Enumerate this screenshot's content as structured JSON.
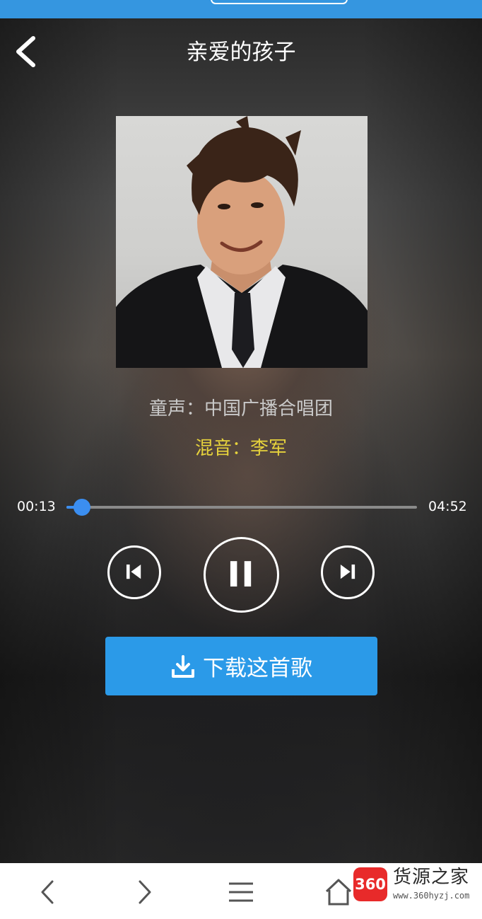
{
  "colors": {
    "accent": "#2b9ae8",
    "progress": "#3b8ef0",
    "mix_text": "#e6d23c",
    "singer_text": "#c9c9c9"
  },
  "header": {
    "title": "亲爱的孩子",
    "back_icon": "chevron-left-icon"
  },
  "cover": {
    "description_icon": "album-art-portrait"
  },
  "credits": {
    "singer": "童声：中国广播合唱团",
    "mix": "混音：李军"
  },
  "player": {
    "current_time": "00:13",
    "total_time": "04:52",
    "progress_fraction": 0.045,
    "prev_icon": "skip-previous-icon",
    "play_icon": "pause-icon",
    "next_icon": "skip-next-icon"
  },
  "download": {
    "label": "下载这首歌",
    "icon": "download-icon"
  },
  "browser_nav": {
    "back_icon": "chevron-left-icon",
    "forward_icon": "chevron-right-icon",
    "menu_icon": "menu-icon",
    "home_icon": "home-icon"
  },
  "watermark": {
    "badge": "360",
    "name": "货源之家",
    "url": "www.360hyzj.com"
  }
}
